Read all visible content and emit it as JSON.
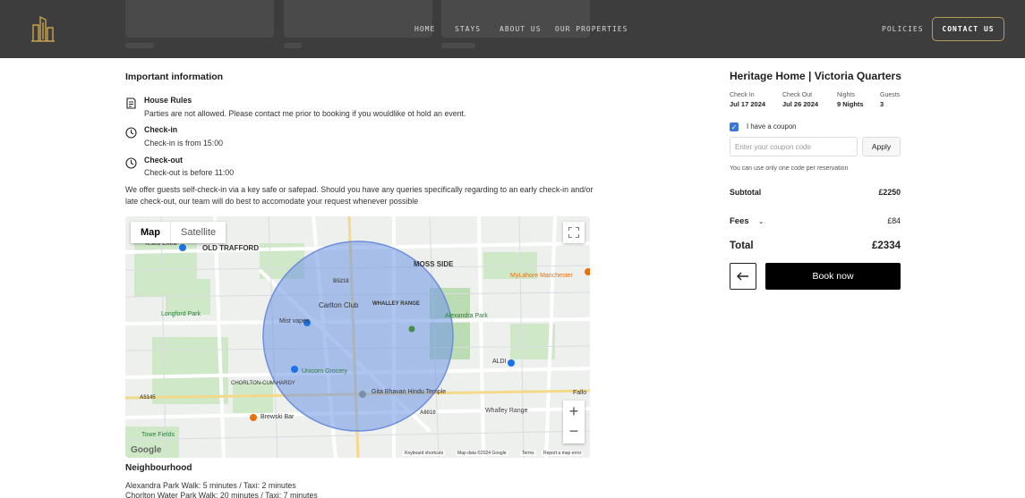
{
  "header": {
    "nav": [
      "HOME",
      "STAYS",
      "ABOUT US",
      "OUR PROPERTIES",
      "POLICIES"
    ],
    "contact_label": "CONTACT US",
    "colors": {
      "bar": "#3d3d3d",
      "accent": "#b69a58"
    }
  },
  "info": {
    "title": "Important information",
    "rules": [
      {
        "icon": "document-icon",
        "title": "House Rules",
        "text": "Parties are not allowed. Please contact me prior to booking if you wouldlike ot hold an event."
      },
      {
        "icon": "clock-icon",
        "title": "Check-in",
        "text": "Check-in is from 15:00"
      },
      {
        "icon": "clock-icon",
        "title": "Check-out",
        "text": "Check-out is before 11:00"
      }
    ],
    "paragraph": "We offer guests self-check-in via a key safe or safepad. Should you have any queries specifically regarding to an early check-in and/or late check-out, our team will do best to accomodate your request whenever possible"
  },
  "map": {
    "tabs": [
      "Map",
      "Satellite"
    ],
    "places": [
      "Tesco Extra",
      "OLD TRAFFORD",
      "MOSS SIDE",
      "MyLahore Manchester",
      "Mist vapes",
      "Carlton Club",
      "WHALLEY RANGE",
      "Alexandra Park",
      "Longford Park",
      "Unicorn Grocery",
      "ALDI",
      "CHORLTON-CUM-HARDY",
      "Gita Bhavan Hindu Temple",
      "Brewski Bar",
      "Whalley Range",
      "Fallo",
      "Towe Fields",
      "A5145",
      "A6010",
      "B5218"
    ],
    "footer": [
      "Keyboard shortcuts",
      "Map data ©2024 Google",
      "Terms",
      "Report a map error"
    ],
    "logo": "Google"
  },
  "neighbourhood": {
    "title": "Neighbourhood",
    "lines": [
      "Alexandra Park Walk: 5 minutes / Taxi: 2 minutes",
      "Chorlton Water Park Walk: 20 minutes / Taxi: 7 minutes"
    ]
  },
  "booking": {
    "property_title": "Heritage Home | Victoria Quarters",
    "check_in_label": "Check In",
    "check_in_value": "Jul 17 2024",
    "check_out_label": "Check Out",
    "check_out_value": "Jul 26 2024",
    "nights_label": "Nights",
    "nights_value": "9 Nights",
    "guests_label": "Guests",
    "guests_value": "3",
    "coupon_checkbox_label": "I have a coupon",
    "coupon_checked": true,
    "coupon_placeholder": "Enter your coupon code",
    "apply_label": "Apply",
    "coupon_note": "You can use only one code per reservation",
    "subtotal_label": "Subtotal",
    "subtotal_value": "£2250",
    "fees_label": "Fees",
    "fees_value": "£84",
    "total_label": "Total",
    "total_value": "£2334",
    "book_label": "Book now"
  }
}
